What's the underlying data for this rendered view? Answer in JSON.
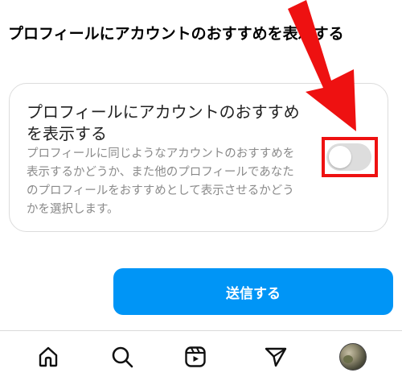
{
  "page": {
    "title": "プロフィールにアカウントのおすすめを表示する"
  },
  "setting": {
    "title": "プロフィールにアカウントのおすすめを表示する",
    "description": "プロフィールに同じようなアカウントのおすすめを表示するかどうか、また他のプロフィールであなたのプロフィールをおすすめとして表示させるかどうかを選択します。",
    "enabled": false
  },
  "submit": {
    "label": "送信する"
  },
  "colors": {
    "accent": "#0095f6",
    "highlight": "#ee1111",
    "toggle_off": "#dddddd"
  },
  "bottom_nav": {
    "items": [
      {
        "icon": "home-icon"
      },
      {
        "icon": "search-icon"
      },
      {
        "icon": "reels-icon"
      },
      {
        "icon": "send-icon"
      },
      {
        "icon": "profile-avatar"
      }
    ]
  }
}
